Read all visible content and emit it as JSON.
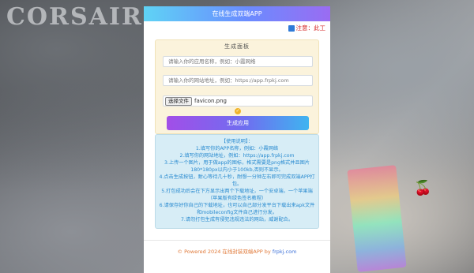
{
  "background": {
    "brand_text": "CORSAIR"
  },
  "app": {
    "title": "在线生成双端APP",
    "notice": "注意：此工"
  },
  "form": {
    "section_title": "生成面板",
    "app_name_placeholder": "请输入你的应用名称，例如：小霞网络",
    "url_placeholder": "请输入你的网站地址，例如：https://app.frpkj.com",
    "file_button": "选择文件",
    "file_name": "favicon.png",
    "submit_label": "生成应用"
  },
  "help": {
    "title": "【使用说明】：",
    "lines": [
      "1.填写你的APP名称，例如：小霞网络",
      "2.填写你的网站地址，例如：https://app.frpkj.com",
      "3.上传一个图片，用于做app的图标，格式需要是png格式并且图片180*180px以内小于100kb,否则不显示。",
      "4.点击生成按钮，耐心等待几十秒，耐想一分钟左右即可完成双端APP打包。",
      "5.打包成功后会在下方显示出两个下载地址，一个安卓端，一个苹果端（苹果版有绿色签名教程）",
      "6.请保存好你自己的下载地址，也可以自己部分发平台下载出来apk文件和mobileconfig文件自己进行分发。",
      "7.请勿打包生成有侵犯违规违法的网站，威谢配合。"
    ]
  },
  "footer": {
    "prefix": "© Powered 2024 在线封装双端APP by ",
    "link": "frpkj.com"
  },
  "colors": {
    "accent_start": "#a24ee8",
    "accent_end": "#3fb4f0",
    "help_text": "#2a8bd0",
    "notice_text": "#d62a2a"
  }
}
